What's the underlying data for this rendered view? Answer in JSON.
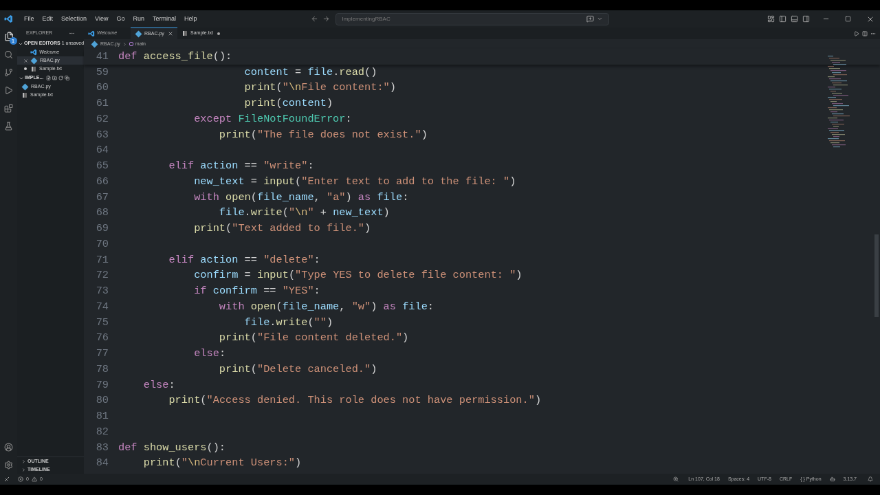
{
  "menu": [
    "File",
    "Edit",
    "Selection",
    "View",
    "Go",
    "Run",
    "Terminal",
    "Help"
  ],
  "command_center": {
    "placeholder": "ImplementingRBAC"
  },
  "activity_bar": {
    "explorer_badge": "1"
  },
  "sidebar": {
    "title": "EXPLORER",
    "open_editors": {
      "title": "OPEN EDITORS",
      "badge": "1 unsaved",
      "expanded": true,
      "items": [
        {
          "name": "Welcome",
          "kind": "welcome",
          "selected": false,
          "dirty": false
        },
        {
          "name": "RBAC.py",
          "kind": "python",
          "selected": true,
          "dirty": false
        },
        {
          "name": "Sample.txt",
          "kind": "text",
          "selected": false,
          "dirty": true
        }
      ]
    },
    "folder": {
      "title": "IMPLE...",
      "expanded": true,
      "items": [
        {
          "name": "RBAC.py",
          "kind": "python",
          "selected": false
        },
        {
          "name": "Sample.txt",
          "kind": "text",
          "selected": false
        }
      ]
    },
    "sections": [
      {
        "title": "OUTLINE",
        "expanded": false
      },
      {
        "title": "TIMELINE",
        "expanded": false
      }
    ]
  },
  "tabs": [
    {
      "label": "Welcome",
      "kind": "welcome",
      "selected": false,
      "dirty": false
    },
    {
      "label": "RBAC.py",
      "kind": "python",
      "selected": true,
      "dirty": false
    },
    {
      "label": "Sample.txt",
      "kind": "text",
      "selected": false,
      "dirty": true
    }
  ],
  "breadcrumb": [
    "RBAC.py",
    "main"
  ],
  "sticky": {
    "number": "41",
    "tokens": [
      {
        "kind": "kw",
        "text": "def "
      },
      {
        "kind": "fn",
        "text": "access_file"
      },
      {
        "kind": "op",
        "text": "():"
      }
    ]
  },
  "lines": [
    {
      "number": "59",
      "tokens": [
        {
          "kind": "var",
          "text": "                    content"
        },
        {
          "kind": "op",
          "text": " = "
        },
        {
          "kind": "var",
          "text": "file"
        },
        {
          "kind": "op",
          "text": "."
        },
        {
          "kind": "fn",
          "text": "read"
        },
        {
          "kind": "op",
          "text": "()"
        }
      ]
    },
    {
      "number": "60",
      "tokens": [
        {
          "kind": "fn",
          "text": "                    print"
        },
        {
          "kind": "op",
          "text": "("
        },
        {
          "kind": "str",
          "text": "\""
        },
        {
          "kind": "esc",
          "text": "\\n"
        },
        {
          "kind": "str",
          "text": "File content:\""
        },
        {
          "kind": "op",
          "text": ")"
        }
      ]
    },
    {
      "number": "61",
      "tokens": [
        {
          "kind": "fn",
          "text": "                    print"
        },
        {
          "kind": "op",
          "text": "("
        },
        {
          "kind": "var",
          "text": "content"
        },
        {
          "kind": "op",
          "text": ")"
        }
      ]
    },
    {
      "number": "62",
      "tokens": [
        {
          "kind": "kw",
          "text": "            except "
        },
        {
          "kind": "cls",
          "text": "FileNotFoundError"
        },
        {
          "kind": "op",
          "text": ":"
        }
      ]
    },
    {
      "number": "63",
      "tokens": [
        {
          "kind": "fn",
          "text": "                print"
        },
        {
          "kind": "op",
          "text": "("
        },
        {
          "kind": "str",
          "text": "\"The file does not exist.\""
        },
        {
          "kind": "op",
          "text": ")"
        }
      ]
    },
    {
      "number": "64"
    },
    {
      "number": "65",
      "tokens": [
        {
          "kind": "kw",
          "text": "        elif "
        },
        {
          "kind": "var",
          "text": "action"
        },
        {
          "kind": "op",
          "text": " == "
        },
        {
          "kind": "str",
          "text": "\"write\""
        },
        {
          "kind": "op",
          "text": ":"
        }
      ]
    },
    {
      "number": "66",
      "tokens": [
        {
          "kind": "var",
          "text": "            new_text"
        },
        {
          "kind": "op",
          "text": " = "
        },
        {
          "kind": "fn",
          "text": "input"
        },
        {
          "kind": "op",
          "text": "("
        },
        {
          "kind": "str",
          "text": "\"Enter text to add to the file: \""
        },
        {
          "kind": "op",
          "text": ")"
        }
      ]
    },
    {
      "number": "67",
      "tokens": [
        {
          "kind": "kw",
          "text": "            with "
        },
        {
          "kind": "fn",
          "text": "open"
        },
        {
          "kind": "op",
          "text": "("
        },
        {
          "kind": "var",
          "text": "file_name"
        },
        {
          "kind": "op",
          "text": ", "
        },
        {
          "kind": "str",
          "text": "\"a\""
        },
        {
          "kind": "op",
          "text": ") "
        },
        {
          "kind": "kw",
          "text": "as "
        },
        {
          "kind": "var",
          "text": "file"
        },
        {
          "kind": "op",
          "text": ":"
        }
      ]
    },
    {
      "number": "68",
      "tokens": [
        {
          "kind": "var",
          "text": "                file"
        },
        {
          "kind": "op",
          "text": "."
        },
        {
          "kind": "fn",
          "text": "write"
        },
        {
          "kind": "op",
          "text": "("
        },
        {
          "kind": "str",
          "text": "\""
        },
        {
          "kind": "esc",
          "text": "\\n"
        },
        {
          "kind": "str",
          "text": "\""
        },
        {
          "kind": "op",
          "text": " + "
        },
        {
          "kind": "var",
          "text": "new_text"
        },
        {
          "kind": "op",
          "text": ")"
        }
      ]
    },
    {
      "number": "69",
      "tokens": [
        {
          "kind": "fn",
          "text": "            print"
        },
        {
          "kind": "op",
          "text": "("
        },
        {
          "kind": "str",
          "text": "\"Text added to file.\""
        },
        {
          "kind": "op",
          "text": ")"
        }
      ]
    },
    {
      "number": "70"
    },
    {
      "number": "71",
      "tokens": [
        {
          "kind": "kw",
          "text": "        elif "
        },
        {
          "kind": "var",
          "text": "action"
        },
        {
          "kind": "op",
          "text": " == "
        },
        {
          "kind": "str",
          "text": "\"delete\""
        },
        {
          "kind": "op",
          "text": ":"
        }
      ]
    },
    {
      "number": "72",
      "tokens": [
        {
          "kind": "var",
          "text": "            confirm"
        },
        {
          "kind": "op",
          "text": " = "
        },
        {
          "kind": "fn",
          "text": "input"
        },
        {
          "kind": "op",
          "text": "("
        },
        {
          "kind": "str",
          "text": "\"Type YES to delete file content: \""
        },
        {
          "kind": "op",
          "text": ")"
        }
      ]
    },
    {
      "number": "73",
      "tokens": [
        {
          "kind": "kw",
          "text": "            if "
        },
        {
          "kind": "var",
          "text": "confirm"
        },
        {
          "kind": "op",
          "text": " == "
        },
        {
          "kind": "str",
          "text": "\"YES\""
        },
        {
          "kind": "op",
          "text": ":"
        }
      ]
    },
    {
      "number": "74",
      "tokens": [
        {
          "kind": "kw",
          "text": "                with "
        },
        {
          "kind": "fn",
          "text": "open"
        },
        {
          "kind": "op",
          "text": "("
        },
        {
          "kind": "var",
          "text": "file_name"
        },
        {
          "kind": "op",
          "text": ", "
        },
        {
          "kind": "str",
          "text": "\"w\""
        },
        {
          "kind": "op",
          "text": ") "
        },
        {
          "kind": "kw",
          "text": "as "
        },
        {
          "kind": "var",
          "text": "file"
        },
        {
          "kind": "op",
          "text": ":"
        }
      ]
    },
    {
      "number": "75",
      "tokens": [
        {
          "kind": "var",
          "text": "                    file"
        },
        {
          "kind": "op",
          "text": "."
        },
        {
          "kind": "fn",
          "text": "write"
        },
        {
          "kind": "op",
          "text": "("
        },
        {
          "kind": "str",
          "text": "\"\""
        },
        {
          "kind": "op",
          "text": ")"
        }
      ]
    },
    {
      "number": "76",
      "tokens": [
        {
          "kind": "fn",
          "text": "                print"
        },
        {
          "kind": "op",
          "text": "("
        },
        {
          "kind": "str",
          "text": "\"File content deleted.\""
        },
        {
          "kind": "op",
          "text": ")"
        }
      ]
    },
    {
      "number": "77",
      "tokens": [
        {
          "kind": "kw",
          "text": "            else"
        },
        {
          "kind": "op",
          "text": ":"
        }
      ]
    },
    {
      "number": "78",
      "tokens": [
        {
          "kind": "fn",
          "text": "                print"
        },
        {
          "kind": "op",
          "text": "("
        },
        {
          "kind": "str",
          "text": "\"Delete canceled.\""
        },
        {
          "kind": "op",
          "text": ")"
        }
      ]
    },
    {
      "number": "79",
      "tokens": [
        {
          "kind": "kw",
          "text": "    else"
        },
        {
          "kind": "op",
          "text": ":"
        }
      ]
    },
    {
      "number": "80",
      "tokens": [
        {
          "kind": "fn",
          "text": "        print"
        },
        {
          "kind": "op",
          "text": "("
        },
        {
          "kind": "str",
          "text": "\"Access denied. This role does not have permission.\""
        },
        {
          "kind": "op",
          "text": ")"
        }
      ]
    },
    {
      "number": "81"
    },
    {
      "number": "82"
    },
    {
      "number": "83",
      "tokens": [
        {
          "kind": "kw",
          "text": "def "
        },
        {
          "kind": "fn",
          "text": "show_users"
        },
        {
          "kind": "op",
          "text": "():"
        }
      ]
    },
    {
      "number": "84",
      "tokens": [
        {
          "kind": "fn",
          "text": "    print"
        },
        {
          "kind": "op",
          "text": "("
        },
        {
          "kind": "str",
          "text": "\""
        },
        {
          "kind": "esc",
          "text": "\\n"
        },
        {
          "kind": "str",
          "text": "Current Users:\""
        },
        {
          "kind": "op",
          "text": ")"
        }
      ]
    }
  ],
  "status_bar": {
    "errors": "0",
    "warnings": "0",
    "right": [
      {
        "kind": "zoom"
      },
      {
        "kind": "text",
        "text": "Ln 107, Col 18"
      },
      {
        "kind": "text",
        "text": "Spaces: 4"
      },
      {
        "kind": "text",
        "text": "UTF-8"
      },
      {
        "kind": "text",
        "text": "CRLF"
      },
      {
        "kind": "text",
        "text": "{ } Python"
      },
      {
        "kind": "copilot"
      },
      {
        "kind": "text",
        "text": "3.13.7"
      },
      {
        "kind": "bell"
      }
    ]
  }
}
